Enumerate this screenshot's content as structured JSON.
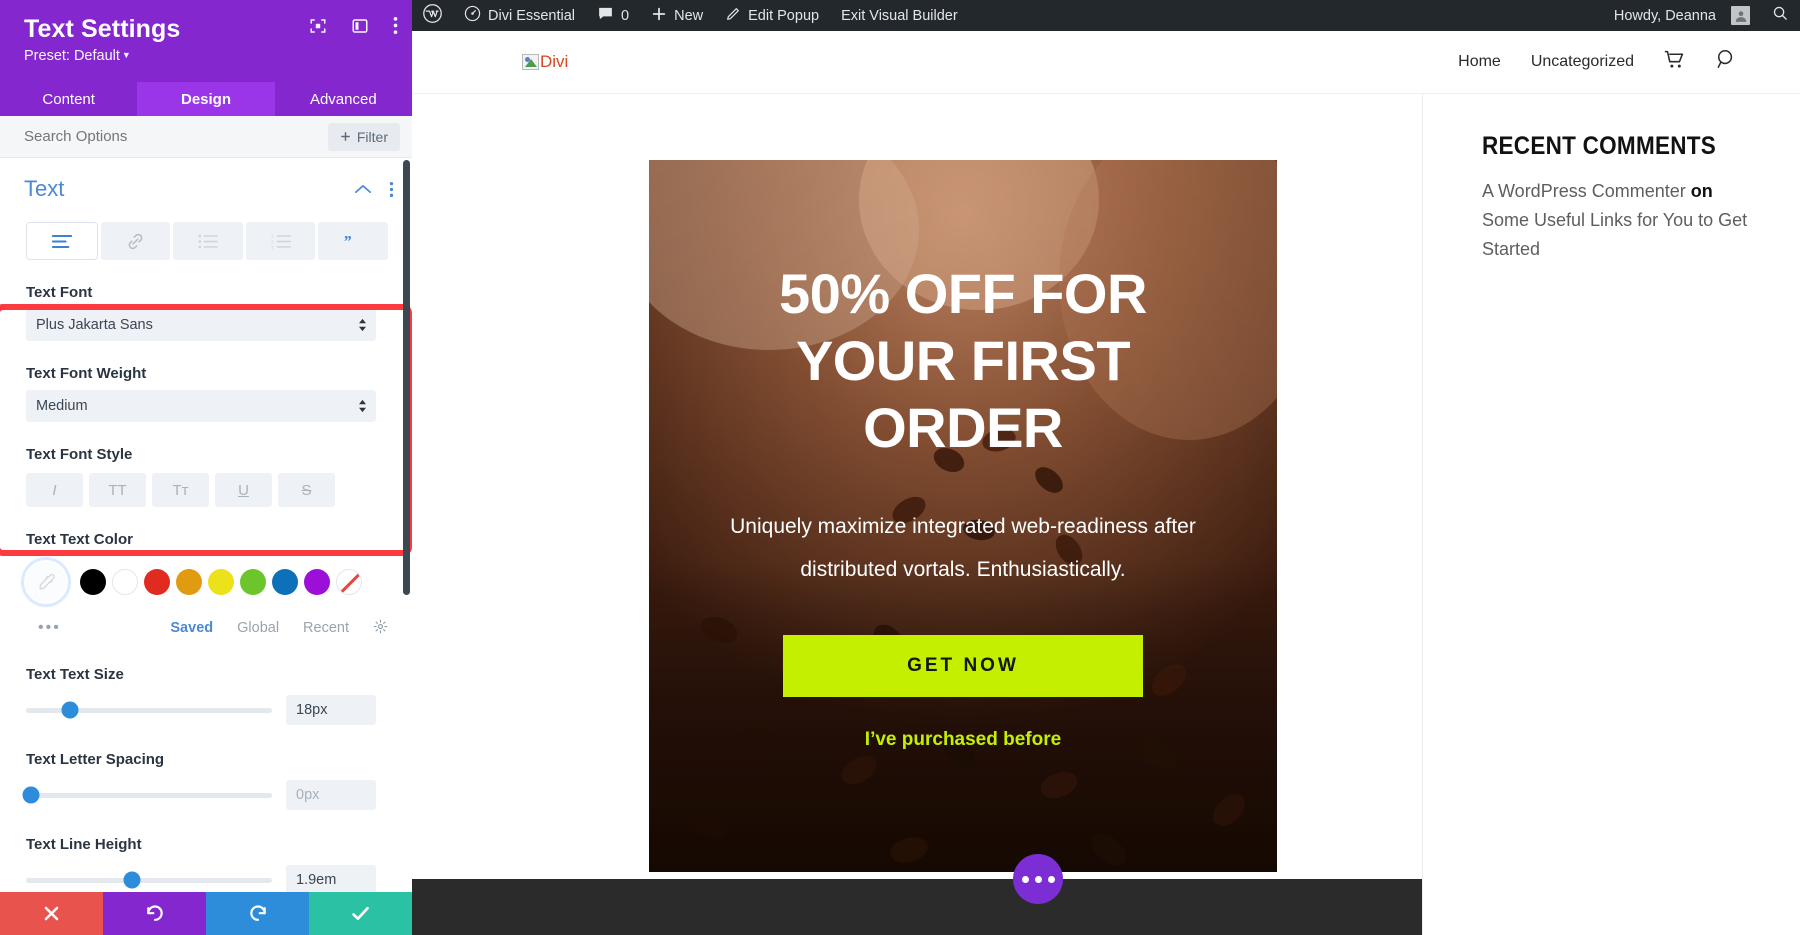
{
  "settings_panel": {
    "title": "Text Settings",
    "preset": "Preset: Default",
    "header_icons": [
      {
        "name": "focus-icon"
      },
      {
        "name": "layout-toggle-icon"
      },
      {
        "name": "more-options-icon"
      }
    ],
    "tabs": [
      {
        "label": "Content",
        "active": false
      },
      {
        "label": "Design",
        "active": true
      },
      {
        "label": "Advanced",
        "active": false
      }
    ],
    "search_placeholder": "Search Options",
    "filter_label": "Filter",
    "section": {
      "title": "Text",
      "icon_tabs": [
        {
          "name": "paragraph-text-icon",
          "glyph": "align",
          "active": true
        },
        {
          "name": "link-icon",
          "glyph": "link",
          "active": false
        },
        {
          "name": "unordered-list-icon",
          "glyph": "ul",
          "active": false
        },
        {
          "name": "ordered-list-icon",
          "glyph": "ol",
          "active": false
        },
        {
          "name": "blockquote-icon",
          "glyph": "quote",
          "active": false
        }
      ],
      "font_label": "Text Font",
      "font_value": "Plus Jakarta Sans",
      "font_weight_label": "Text Font Weight",
      "font_weight_value": "Medium",
      "font_style_label": "Text Font Style",
      "font_style_buttons": [
        {
          "name": "italic-button",
          "glyph": "I"
        },
        {
          "name": "uppercase-button",
          "glyph": "TT"
        },
        {
          "name": "smallcaps-button",
          "glyph": "Tᴛ"
        },
        {
          "name": "underline-button",
          "glyph": "U"
        },
        {
          "name": "strikethrough-button",
          "glyph": "S"
        }
      ],
      "text_color_label": "Text Text Color",
      "swatches": [
        "#000000",
        "#ffffff",
        "#e02b20",
        "#e09b11",
        "#ece21a",
        "#6cc62b",
        "#0d71ba",
        "#9b0fd8"
      ],
      "palette_links": [
        {
          "label": "Saved",
          "active": true
        },
        {
          "label": "Global",
          "active": false
        },
        {
          "label": "Recent",
          "active": false
        }
      ],
      "sliders": [
        {
          "label": "Text Text Size",
          "value": "18px",
          "pos": 18,
          "muted": false
        },
        {
          "label": "Text Letter Spacing",
          "value": "0px",
          "pos": 2,
          "muted": true
        },
        {
          "label": "Text Line Height",
          "value": "1.9em",
          "pos": 43,
          "muted": false
        }
      ]
    },
    "footer_buttons": [
      {
        "name": "cancel-button",
        "glyph": "✕",
        "color": "#e8534e"
      },
      {
        "name": "undo-button",
        "glyph": "↺",
        "color": "#8427ce"
      },
      {
        "name": "redo-button",
        "glyph": "↻",
        "color": "#2d8ddb"
      },
      {
        "name": "save-button",
        "glyph": "✓",
        "color": "#2ac1a4"
      }
    ]
  },
  "admin_bar": {
    "wp_logo": "wordpress-logo-icon",
    "site_name": "Divi Essential",
    "comment_count": "0",
    "new_label": "New",
    "edit_label": "Edit Popup",
    "exit_label": "Exit Visual Builder",
    "howdy": "Howdy, Deanna"
  },
  "site_header": {
    "logo_alt": "Divi",
    "nav": [
      {
        "label": "Home"
      },
      {
        "label": "Uncategorized"
      }
    ],
    "cart_icon": "shopping-cart-icon",
    "search_icon": "search-icon"
  },
  "popup": {
    "heading": "50% OFF FOR YOUR FIRST ORDER",
    "paragraph": "Uniquely maximize integrated web-readiness after distributed vortals. Enthusiastically.",
    "button_label": "GET NOW",
    "link_label": "I’ve purchased before",
    "button_color": "#c4f000"
  },
  "widget": {
    "title": "RECENT COMMENTS",
    "author": "A WordPress Commenter",
    "on": "on",
    "post": "Some Useful Links for You to Get Started"
  },
  "fab": {
    "name": "page-settings-fab"
  }
}
